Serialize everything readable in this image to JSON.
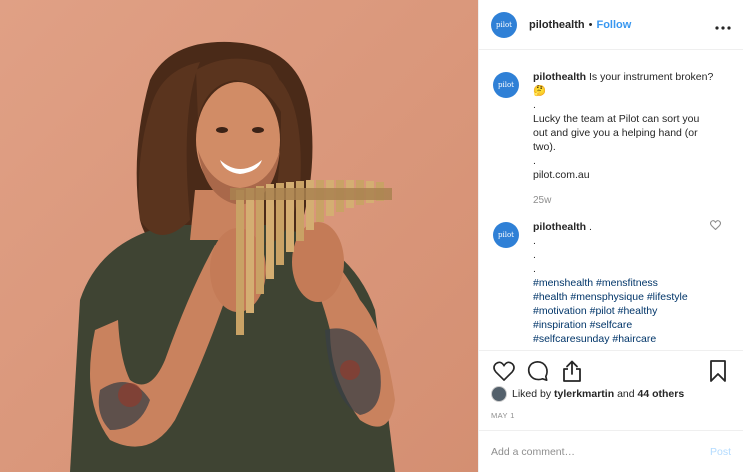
{
  "post": {
    "username": "pilothealth",
    "avatar_text": "pilot",
    "follow_label": "Follow",
    "dot": "•",
    "more_icon": "more-options-icon",
    "caption": {
      "lines": [
        "Is your instrument broken? 🤔",
        ".",
        "Lucky the team at Pilot can sort you out and give you a helping hand (or two).",
        ".",
        "pilot.com.au"
      ],
      "timestamp": "25w"
    },
    "comment": {
      "username": "pilothealth",
      "text": ".",
      "dots": [
        ".",
        ".",
        "."
      ],
      "hashtags": [
        "#menshealth #mensfitness",
        "#health #mensphysique #lifestyle",
        "#motivation #pilot #healthy",
        "#inspiration #selfcare",
        "#selfcaresunday #haircare"
      ]
    },
    "likes": {
      "prefix": "Liked by",
      "user": "tylerkmartin",
      "and": "and",
      "others": "44 others"
    },
    "date": "MAY 1",
    "add_comment_placeholder": "Add a comment…",
    "post_label": "Post"
  },
  "colors": {
    "brand_blue": "#2f80d6",
    "follow_blue": "#3897f0",
    "photo_bg": "#dc9a7c",
    "post_disabled": "#b3dbff"
  }
}
